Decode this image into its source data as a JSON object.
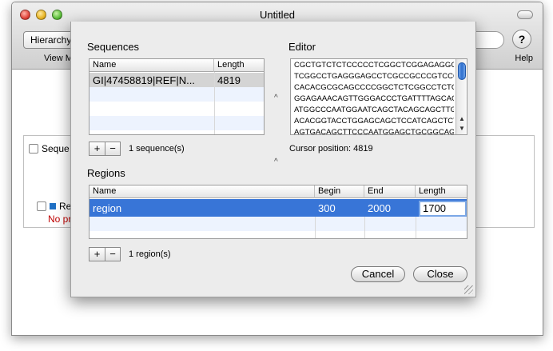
{
  "window": {
    "title": "Untitled",
    "toolbar": {
      "hierarchy_button": "Hierarchy",
      "view_label": "View M",
      "help_label": "Help",
      "help_symbol": "?"
    },
    "background": {
      "sequence_checkbox_label": "Seque",
      "region_checkbox_label": "Re",
      "no_preview_text": "No pr"
    }
  },
  "sheet": {
    "sequences": {
      "title": "Sequences",
      "columns": [
        "Name",
        "Length"
      ],
      "rows": [
        {
          "name": "GI|47458819|REF|N...",
          "length": "4819"
        }
      ],
      "count_label": "1 sequence(s)",
      "add_symbol": "+",
      "remove_symbol": "−"
    },
    "editor": {
      "title": "Editor",
      "lines": [
        "CGCTGTCTCTCCCCCTCGGCTCGGAGAGGCCCT",
        "TCGGCCTGAGGGAGCCTCGCCGCCCGTCCCGG",
        "CACACGCGCAGCCCCGGCTCTCGGCCTCTGCC",
        "GGAGAAACAGTTGGGACCCTGATTTTAGCAGG",
        "ATGGCCCAATGGAATCAGCTACAGCAGCTTGAC",
        "ACACGGTACCTGGAGCAGCTCCATCAGCTCTAC",
        "AGTGACAGCTTCCCAATGGAGCTGCGGCAGTTT"
      ],
      "cursor_label": "Cursor position: 4819"
    },
    "regions": {
      "title": "Regions",
      "columns": [
        "Name",
        "Begin",
        "End",
        "Length"
      ],
      "rows": [
        {
          "name": "region",
          "begin": "300",
          "end": "2000",
          "length": "1700"
        }
      ],
      "count_label": "1 region(s)",
      "add_symbol": "+",
      "remove_symbol": "−"
    },
    "buttons": {
      "cancel": "Cancel",
      "close": "Close"
    },
    "splitter_symbol": "^",
    "colors": {
      "selection": "#3875d7",
      "stripe": "#edf3fe",
      "scroll_thumb": "#2f6fce"
    }
  }
}
